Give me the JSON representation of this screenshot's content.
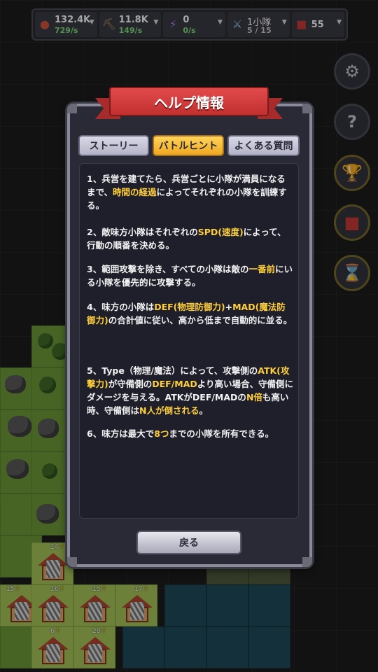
{
  "resources": [
    {
      "icon": "meat-icon",
      "value": "132.4K",
      "rate": "729/s",
      "color": "#7fe07a"
    },
    {
      "icon": "pickaxe-icon",
      "value": "11.8K",
      "rate": "149/s",
      "color": "#7fe07a"
    },
    {
      "icon": "lightning-icon",
      "value": "0",
      "rate": "0/s",
      "color": "#7fe07a"
    },
    {
      "icon": "sword-icon",
      "value": "1小隊",
      "rate": "5 / 15",
      "color": "#cccccc"
    },
    {
      "icon": "book-icon",
      "value": "55",
      "rate": ""
    }
  ],
  "tiles": {
    "levels": [
      "14",
      "15",
      "16",
      "15",
      "17",
      "6",
      "28"
    ]
  },
  "dialog": {
    "title": "ヘルプ情報",
    "tabs": [
      {
        "label": "ストーリー",
        "active": false
      },
      {
        "label": "バトルヒント",
        "active": true
      },
      {
        "label": "よくある質問",
        "active": false
      }
    ],
    "hints": [
      [
        {
          "t": "1、兵営を建てたら、兵営ごとに小隊が満員になるまで、"
        },
        {
          "t": "時間の経過",
          "hl": true
        },
        {
          "t": "によってそれぞれの小隊を訓練する。"
        }
      ],
      [
        {
          "t": "2、敵味方小隊はそれぞれの"
        },
        {
          "t": "SPD(速度)",
          "hl": true
        },
        {
          "t": "によって、行動の順番を決める。"
        }
      ],
      [
        {
          "t": "3、範囲攻撃を除き、すべての小隊は敵の"
        },
        {
          "t": "一番前",
          "hl": true
        },
        {
          "t": "にいる小隊を優先的に攻撃する。"
        }
      ],
      [
        {
          "t": "4、味方の小隊は"
        },
        {
          "t": "DEF(物理防御力)",
          "hl": true
        },
        {
          "t": "+"
        },
        {
          "t": "MAD(魔法防御力)",
          "hl": true
        },
        {
          "t": "の合計値に従い、高から低まで自動的に並る。"
        }
      ],
      [
        {
          "t": "5、Type（物理/魔法）によって、攻撃側の"
        },
        {
          "t": "ATK(攻撃力)",
          "hl": true
        },
        {
          "t": "が守備側の"
        },
        {
          "t": "DEF/MAD",
          "hl": true
        },
        {
          "t": "より高い場合、守備側にダメージを与える。ATKがDEF/MADの"
        },
        {
          "t": "N倍",
          "hl": true
        },
        {
          "t": "も高い時、守備側は"
        },
        {
          "t": "N人が倒される",
          "hl": true
        },
        {
          "t": "。"
        }
      ],
      [
        {
          "t": "6、味方は最大で"
        },
        {
          "t": "8つ",
          "hl": true
        },
        {
          "t": "までの小隊を所有できる。"
        }
      ]
    ],
    "back_label": "戻る"
  },
  "colors": {
    "highlight": "#ffcf3a",
    "ribbon": "#d23c3c",
    "tab_active": "#f8bf3a"
  }
}
